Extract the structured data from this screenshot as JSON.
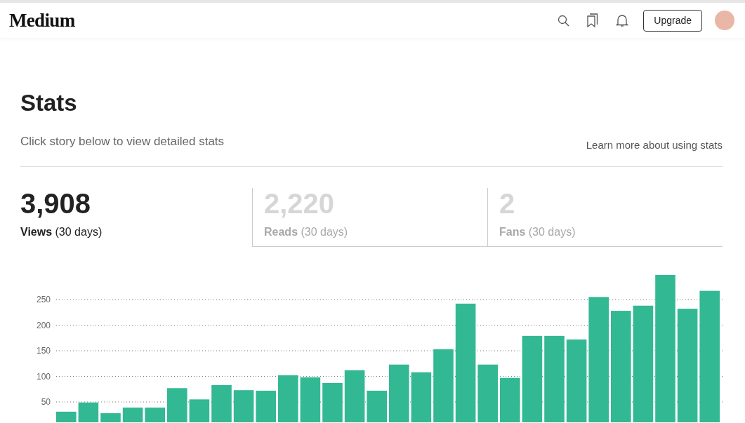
{
  "header": {
    "logo": "Medium",
    "upgrade_button": "Upgrade"
  },
  "page": {
    "title": "Stats",
    "subtitle": "Click story below to view detailed stats",
    "help_link": "Learn more about using stats"
  },
  "metric_tabs": [
    {
      "value": "3,908",
      "label": "Views",
      "period": "(30 days)",
      "selected": true
    },
    {
      "value": "2,220",
      "label": "Reads",
      "period": "(30 days)",
      "selected": false
    },
    {
      "value": "2",
      "label": "Fans",
      "period": "(30 days)",
      "selected": false
    }
  ],
  "chart": {
    "chart_data": {
      "type": "bar",
      "grid": true,
      "ylim": [
        0,
        300
      ],
      "series": [
        {
          "color": "#33b894",
          "values": [
            31,
            49,
            28,
            39,
            39,
            77,
            55,
            83,
            73,
            72,
            102,
            98,
            87,
            112,
            72,
            123,
            108,
            153,
            242,
            123,
            97,
            179,
            179,
            172,
            255,
            228,
            238,
            298,
            232,
            267
          ]
        }
      ],
      "yticks": [
        50,
        100,
        150,
        200,
        250
      ]
    }
  }
}
